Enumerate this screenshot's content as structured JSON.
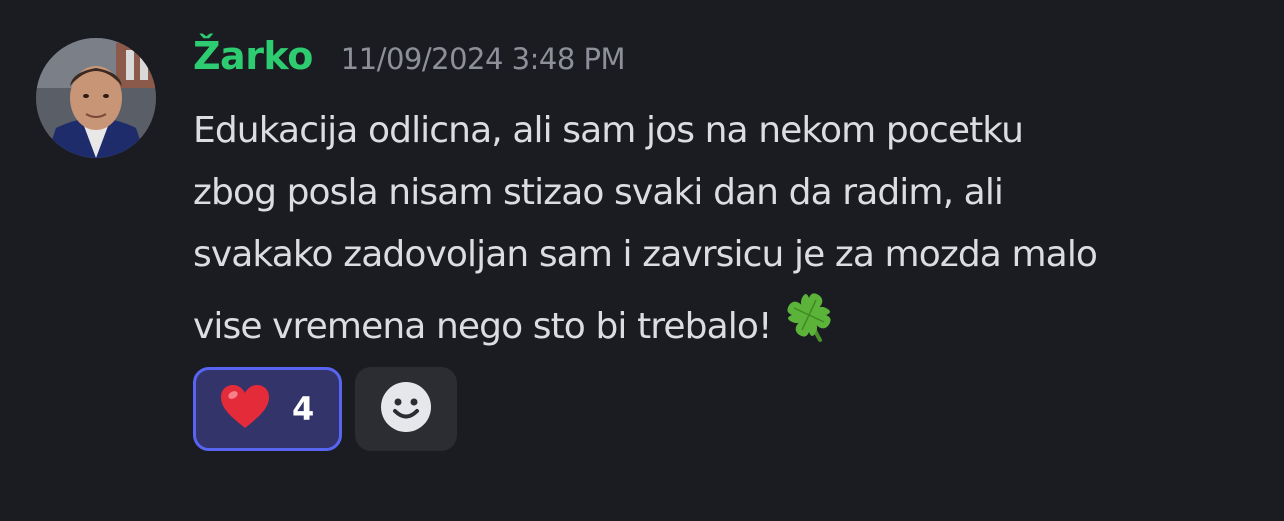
{
  "message": {
    "author": "Žarko",
    "timestamp": "11/09/2024 3:48 PM",
    "lines": [
      "Edukacija odlicna, ali sam jos na nekom pocetku",
      "zbog posla nisam stizao svaki dan da radim, ali",
      "svakako zadovoljan sam i zavrsicu je za mozda malo",
      "vise vremena nego sto bi trebalo!"
    ],
    "trailing_emoji": "four-leaf-clover"
  },
  "reactions": [
    {
      "emoji": "red-heart",
      "count": "4",
      "active": true
    }
  ],
  "add_reaction": {
    "icon": "smiley-face-icon"
  },
  "colors": {
    "background": "#1b1c21",
    "username": "#2ecc71",
    "timestamp": "#8e9099",
    "text": "#dcdde1",
    "reaction_active_bg": "#32346a",
    "reaction_active_border": "#5865f2",
    "add_reaction_bg": "#2b2d33"
  }
}
